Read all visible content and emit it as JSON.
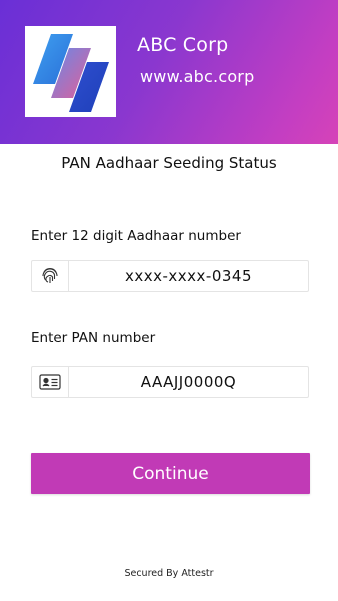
{
  "header": {
    "company_name": "ABC Corp",
    "company_url": "www.abc.corp",
    "logo_icon": "abc-corp-logo-icon",
    "gradient_start": "#6a2fd6",
    "gradient_end": "#d643b8"
  },
  "page": {
    "title": "PAN Aadhaar Seeding Status"
  },
  "aadhaar": {
    "label": "Enter 12 digit Aadhaar number",
    "value": "xxxx-xxxx-0345",
    "icon": "fingerprint-icon"
  },
  "pan": {
    "label": "Enter PAN number",
    "value": "AAAJJ0000Q",
    "icon": "id-card-icon"
  },
  "actions": {
    "continue_label": "Continue",
    "button_color": "#c13ab6"
  },
  "footer": {
    "text": "Secured By Attestr"
  }
}
